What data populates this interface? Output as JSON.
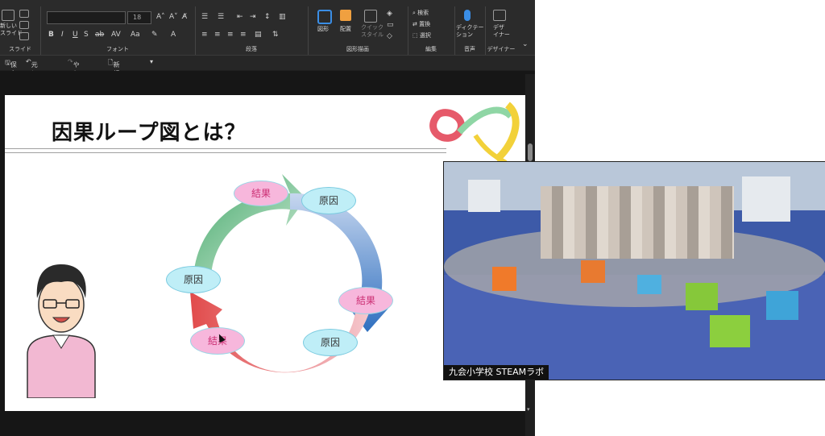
{
  "ribbon": {
    "slides_group": "スライド",
    "new_slide": "新しい\nスライド",
    "font_group": "フォント",
    "paragraph_group": "段落",
    "drawing_group": "図形描画",
    "shape_label": "図形",
    "arrange_label": "配置",
    "quick_style_label": "クイック\nスタイル",
    "editing_group": "編集",
    "find_label": "検索",
    "replace_label": "置換",
    "select_label": "選択",
    "voice_group": "音声",
    "dictate_label": "ディクテー\nション",
    "designer_group": "デザイナー",
    "design_label": "デザ\nイナー",
    "font_size": "18"
  },
  "qat": {
    "save": "保存",
    "undo": "元に戻す",
    "redo": "やり直し",
    "new": "新規作成"
  },
  "slide": {
    "title": "因果ループ図とは？",
    "labels": {
      "result_top": "結果",
      "cause_top": "原因",
      "cause_left": "原因",
      "result_right": "結果",
      "result_bottom": "結果",
      "cause_bottom": "原因"
    }
  },
  "webcam": {
    "caption": "九会小学校 STEAMラボ"
  },
  "colors": {
    "ribbon_bg": "#2b2b2b",
    "result_fill": "#f7b7dc",
    "cause_fill": "#bfeef7"
  }
}
